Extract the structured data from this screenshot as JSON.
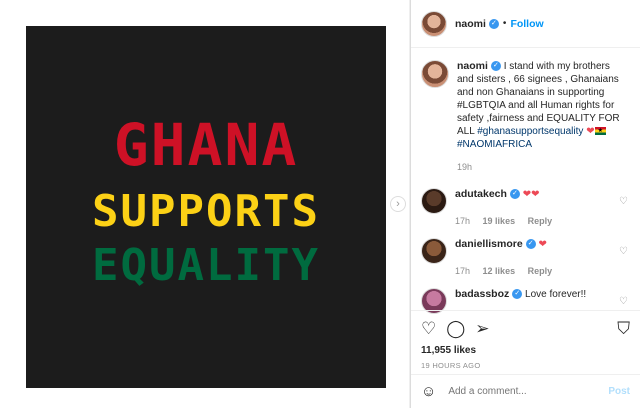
{
  "photo": {
    "line1": "GHANA",
    "line2": "SUPPORTS",
    "line3": "EQUALITY",
    "colors": {
      "background": "#1c1c1c",
      "line1": "#ce1126",
      "line2": "#fcd116",
      "line3": "#006b3f"
    }
  },
  "header": {
    "username": "naomi",
    "dot": "•",
    "follow_label": "Follow"
  },
  "caption": {
    "username": "naomi",
    "text": "I stand with my brothers and sisters , 66 signees , Ghanaians and non Ghanaians in supporting #LGBTQIA and all Human rights for safety ,fairness and EQUALITY FOR ALL",
    "hashtag1": "#ghanasupportsequality",
    "hearts": "❤",
    "hashtag2": "#NAOMIAFRICA",
    "time": "19h"
  },
  "comments": [
    {
      "username": "adutakech",
      "text": "❤❤",
      "time": "17h",
      "likes": "19 likes",
      "reply": "Reply"
    },
    {
      "username": "daniellismore",
      "text": "❤",
      "time": "17h",
      "likes": "12 likes",
      "reply": "Reply"
    },
    {
      "username": "badassboz",
      "text": "Love forever!!"
    }
  ],
  "actions": {
    "like_icon": "heart-icon",
    "comment_icon": "comment-icon",
    "share_icon": "share-icon",
    "save_icon": "bookmark-icon",
    "likes_count": "11,955 likes",
    "posted_ago": "19 HOURS AGO"
  },
  "add_comment": {
    "placeholder": "Add a comment...",
    "post_label": "Post"
  }
}
